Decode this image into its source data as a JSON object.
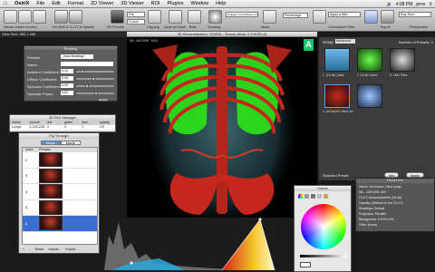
{
  "menubar": {
    "items": [
      "OsiriX",
      "File",
      "Edit",
      "Format",
      "2D Viewer",
      "3D Viewer",
      "ROI",
      "Plugins",
      "Window",
      "Help"
    ],
    "clock": "4:08 PM",
    "user": "jerre"
  },
  "toolbar": {
    "buttons": [
      {
        "label": "Mouse button function"
      },
      {
        "label": "WL/WW & CLUT & Opacity"
      },
      {
        "label": "3D Presets"
      },
      {
        "label": "Clipping"
      },
      {
        "label": "Level of Detail"
      },
      {
        "label": "Best"
      },
      {
        "label": "Shading"
      },
      {
        "label": "Mode"
      },
      {
        "label": "3D Presets"
      },
      {
        "label": "Perspective"
      },
      {
        "label": "Convolution Filter"
      },
      {
        "label": "Orientation"
      },
      {
        "label": "Export"
      },
      {
        "label": "Fly-Thru"
      },
      {
        "label": "Engine"
      }
    ],
    "fields": {
      "file": "File",
      "cursor": "Cursor",
      "shading_info": "Ambient 0.12 Diffuse 0.43 Specular 0.25",
      "percentage": "Percentage",
      "convolution_value": "Apply a filter",
      "mode_value": "Ray-Sum"
    }
  },
  "view_size": "View Size: 685 x 686",
  "window_title": "3D Reconstruction: OSIRIX - Thorax-Abdo: 2.0 B25f (4)",
  "viewport": {
    "info": "WL: 400 WW: 1044",
    "orientation_letter": "A"
  },
  "shading_panel": {
    "title": "Shading",
    "preset_label": "Presets:",
    "preset_value": "_Java shadings",
    "rows": [
      {
        "label": "Name:",
        "value": ""
      },
      {
        "label": "Ambient Coefficient:",
        "value": "0.12"
      },
      {
        "label": "Diffuse Coefficient:",
        "value": "0.43"
      },
      {
        "label": "Specular Coefficient:",
        "value": "0.25"
      },
      {
        "label": "Specular Power:",
        "value": "5.00"
      }
    ],
    "apply_label": "apply"
  },
  "roi_manager": {
    "title": "3D ROI Manager",
    "columns": [
      "Name",
      "volume",
      "red",
      "green",
      "blue",
      "opacity"
    ],
    "rows": [
      [
        "Lungs",
        "4,244.226",
        "0",
        "0",
        "1",
        "0.5"
      ]
    ]
  },
  "fly_through": {
    "title": "Fly Through",
    "tabs": [
      "Steps",
      "Movie"
    ],
    "columns": [
      "Index",
      "Preview"
    ],
    "rows": [
      "2",
      "3",
      "4",
      "5",
      "6"
    ],
    "selected_row": "6",
    "buttons": [
      "+",
      "-",
      "Reset",
      "Import...",
      "Export..."
    ]
  },
  "presets_panel": {
    "group_label": "Group:",
    "group_value": "Advanced",
    "count_text": "Number of Presets: 4",
    "presets": [
      {
        "label": "1. (16 bit) Quick"
      },
      {
        "label": "2. 16-bit Green"
      },
      {
        "label": "3. Little Piles"
      },
      {
        "label": "4. red bones / blue lun"
      }
    ],
    "selected_label": "Selected Preset:",
    "info_button": "Info",
    "apply_button": "Apply"
  },
  "colors_panel": {
    "title": "Colors"
  },
  "preset_info": {
    "title": "Preset Info",
    "lines": [
      "Name: red bones / blue lungs",
      "WL: -825 WW: 822",
      "CLUT: thoracicbluebis (16 bit)",
      "Opacity: (defined in the CLUT)",
      "Shadings: Default",
      "Projection: Parallel",
      "Background: 0.0% 0.0%",
      "Filter: (none)"
    ]
  },
  "colors": {
    "accent_blue": "#3b6fd0",
    "orient_green": "#19c36a",
    "lung_green": "#2ee61a",
    "bone_red": "#c4281c"
  }
}
